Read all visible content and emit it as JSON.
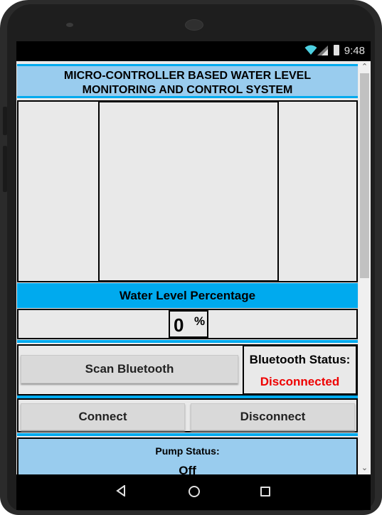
{
  "status_bar": {
    "time": "9:48"
  },
  "app": {
    "title_line1": "MICRO-CONTROLLER BASED WATER LEVEL",
    "title_line2": "MONITORING AND CONTROL SYSTEM"
  },
  "water_level": {
    "header": "Water Level Percentage",
    "value": "0",
    "unit": "%"
  },
  "bluetooth": {
    "scan_label": "Scan Bluetooth",
    "status_label": "Bluetooth Status:",
    "status_value": "Disconnected",
    "status_color": "#ee0000"
  },
  "connection": {
    "connect_label": "Connect",
    "disconnect_label": "Disconnect"
  },
  "pump": {
    "status_label": "Pump Status:",
    "status_value": "Off"
  },
  "colors": {
    "accent": "#00aaee",
    "panel_light_blue": "#99ccee"
  },
  "icons": {
    "wifi": "wifi-icon",
    "signal": "cell-signal-icon",
    "battery": "battery-icon",
    "back": "nav-back-icon",
    "home": "nav-home-icon",
    "recent": "nav-recent-icon"
  }
}
